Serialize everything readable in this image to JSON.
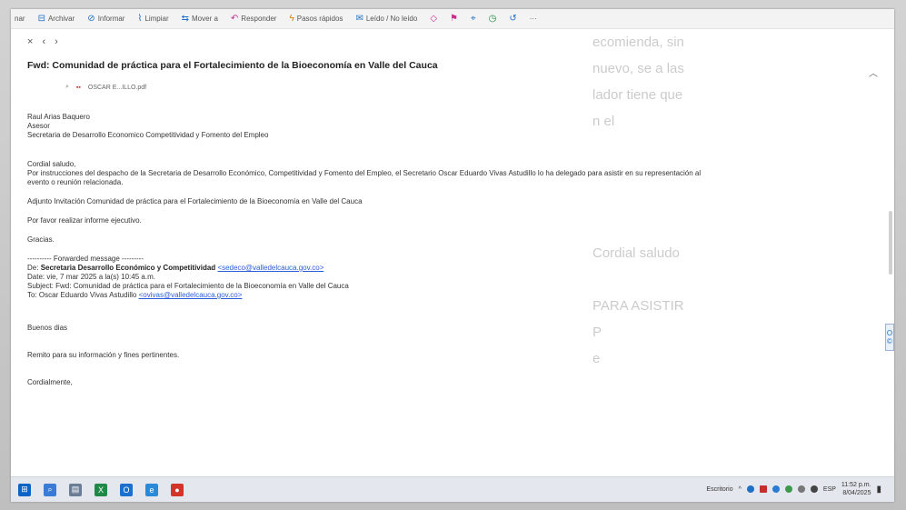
{
  "toolbar": {
    "items": [
      {
        "icon": "menu-fragment",
        "label": "nar"
      },
      {
        "icon": "archive-icon",
        "label": "Archivar"
      },
      {
        "icon": "report-icon",
        "label": "Informar"
      },
      {
        "icon": "broom-icon",
        "label": "Limpiar"
      },
      {
        "icon": "move-icon",
        "label": "Mover a"
      },
      {
        "icon": "reply-icon",
        "label": "Responder"
      },
      {
        "icon": "lightning-icon",
        "label": "Pasos rápidos"
      },
      {
        "icon": "envelope-icon",
        "label": "Leído / No leído"
      }
    ],
    "more": "···"
  },
  "nav": {
    "close": "×",
    "back": "‹",
    "forward": "›"
  },
  "email": {
    "subject": "Fwd: Comunidad de práctica para el Fortalecimiento de la Bioeconomía en Valle del Cauca",
    "attachment": "OSCAR E...ILLO.pdf",
    "sender_block": [
      "Raul Arias Baquero",
      "Asesor",
      "Secretaria de Desarrollo Economico  Competitividad y Fomento del Empleo"
    ],
    "greeting": "Cordial saludo,",
    "instruction_line1": "Por instrucciones del despacho  de la Secretaria de Desarrollo Económico, Competitividad y Fomento del Empleo, el Secretario Oscar Eduardo Vivas Astudillo  lo ha delegado para  asistir en su representación al",
    "instruction_line2": "evento o reunión relacionada.",
    "adjunto": "Adjunto Invitación  Comunidad de práctica para el Fortalecimiento de la Bioeconomía en Valle del Cauca",
    "request": "Por favor realizar informe ejecutivo.",
    "thanks": "Gracias.",
    "forwarded_header": "---------- Forwarded message ---------",
    "from_label": "De:",
    "from_name": "Secretaria Desarrollo Económico y Competitividad",
    "from_email": "<sedeco@valledelcauca.gov.co>",
    "date": "Date: vie, 7 mar 2025 a la(s) 10:45 a.m.",
    "fwd_subject": "Subject: Fwd: Comunidad de práctica para el Fortalecimiento de la Bioeconomía en Valle del Cauca",
    "to_label": "To: Oscar Eduardo Vivas Astudillo",
    "to_email": "<ovivas@valledelcauca.gov.co>",
    "buenos": "Buenos dias",
    "remito": "Remito para su información y fines pertinentes.",
    "cordialmente": "Cordialmente,"
  },
  "background_bleed": [
    "ecomienda, sin",
    "nuevo, se a las",
    "lador tiene que",
    "n el",
    "",
    "",
    "",
    "",
    "Cordial saludo",
    "",
    "PARA ASISTIR",
    "P",
    "e",
    "",
    ""
  ],
  "side_badge": {
    "top": "O",
    "bottom": "©"
  },
  "taskbar": {
    "tray_label": "Escritorio",
    "time": "11:52 p.m.",
    "date": "8/04/2025",
    "lang": "ESP"
  },
  "colors": {
    "accent": "#1f6fc4",
    "link": "#2a5bd7",
    "pdf": "#c4312b"
  }
}
